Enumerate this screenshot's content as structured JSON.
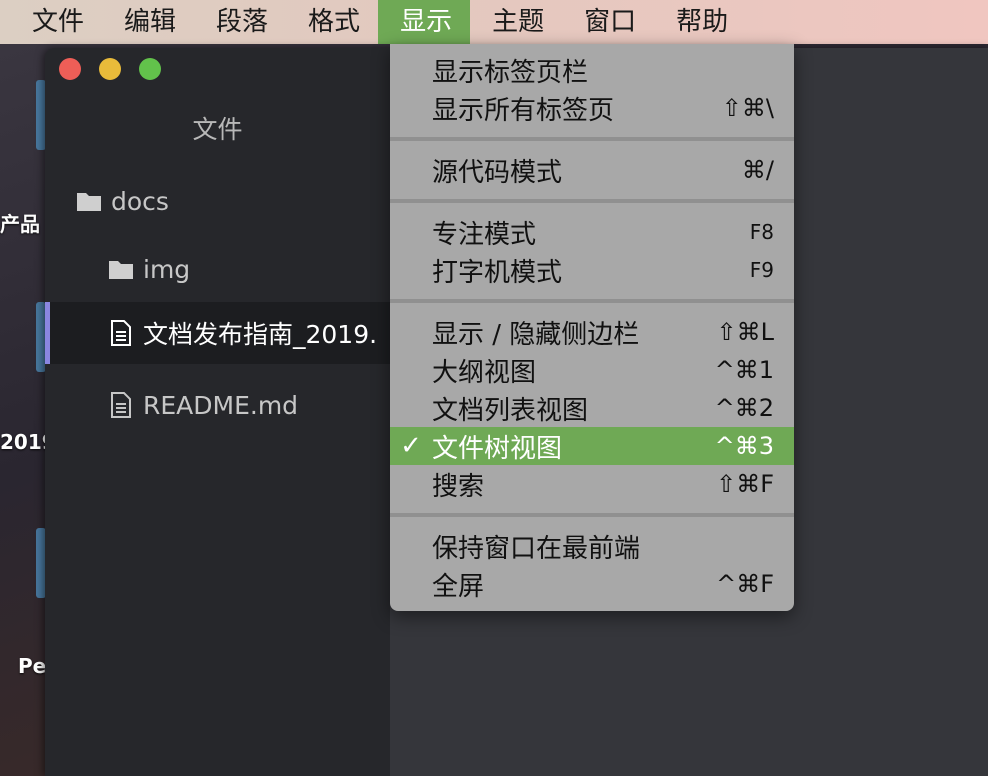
{
  "menubar": {
    "items": [
      "文件",
      "编辑",
      "段落",
      "格式",
      "显示",
      "主题",
      "窗口",
      "帮助"
    ],
    "active_index": 4
  },
  "desktop": {
    "labels": [
      "产品",
      "2019",
      "Pe"
    ]
  },
  "window": {
    "sidebar_title": "文件",
    "tree": [
      {
        "label": "docs",
        "icon": "folder-icon"
      },
      {
        "label": "img",
        "icon": "folder-icon"
      },
      {
        "label": "文档发布指南_2019.",
        "icon": "document-icon",
        "selected": true
      },
      {
        "label": "README.md",
        "icon": "document-icon"
      }
    ]
  },
  "dropdown": {
    "items": [
      {
        "label": "显示标签页栏",
        "shortcut": ""
      },
      {
        "label": "显示所有标签页",
        "shortcut": "⇧⌘\\"
      },
      {
        "label": "源代码模式",
        "shortcut": "⌘/"
      },
      {
        "label": "专注模式",
        "shortcut": "F8"
      },
      {
        "label": "打字机模式",
        "shortcut": "F9"
      },
      {
        "label": "显示 / 隐藏侧边栏",
        "shortcut": "⇧⌘L"
      },
      {
        "label": "大纲视图",
        "shortcut": "^⌘1"
      },
      {
        "label": "文档列表视图",
        "shortcut": "^⌘2"
      },
      {
        "label": "文件树视图",
        "shortcut": "^⌘3",
        "checked": true,
        "check": "✓"
      },
      {
        "label": "搜索",
        "shortcut": "⇧⌘F"
      },
      {
        "label": "保持窗口在最前端",
        "shortcut": ""
      },
      {
        "label": "全屏",
        "shortcut": "^⌘F"
      }
    ]
  },
  "colors": {
    "accent_green": "#6fa955",
    "selection_bar": "#8a86e0"
  }
}
